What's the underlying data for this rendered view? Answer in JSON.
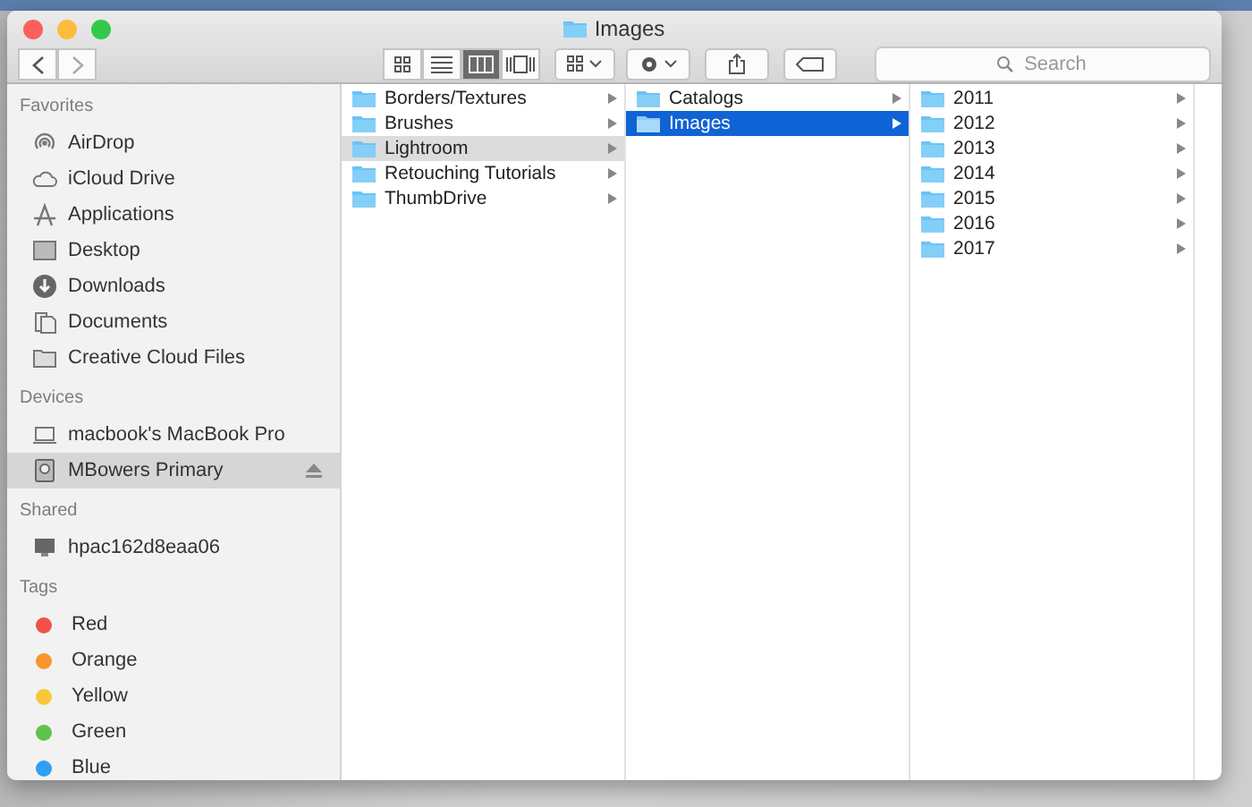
{
  "window": {
    "title": "Images"
  },
  "toolbar": {
    "views": [
      {
        "kind": "icons",
        "selected": false
      },
      {
        "kind": "list",
        "selected": false
      },
      {
        "kind": "columns",
        "selected": true
      },
      {
        "kind": "coverflow",
        "selected": false
      }
    ],
    "search": {
      "placeholder": "Search"
    }
  },
  "sidebar": {
    "sections": [
      {
        "title": "Favorites",
        "items": [
          {
            "label": "AirDrop",
            "selected": false
          },
          {
            "label": "iCloud Drive",
            "selected": false
          },
          {
            "label": "Applications",
            "selected": false
          },
          {
            "label": "Desktop",
            "selected": false
          },
          {
            "label": "Downloads",
            "selected": false
          },
          {
            "label": "Documents",
            "selected": false
          },
          {
            "label": "Creative Cloud Files",
            "selected": false
          }
        ]
      },
      {
        "title": "Devices",
        "items": [
          {
            "label": "macbook's MacBook Pro",
            "selected": false,
            "ejectable": false
          },
          {
            "label": "MBowers Primary",
            "selected": true,
            "ejectable": true
          }
        ]
      },
      {
        "title": "Shared",
        "items": [
          {
            "label": "hpac162d8eaa06",
            "selected": false
          }
        ]
      },
      {
        "title": "Tags",
        "items": [
          {
            "label": "Red",
            "color": "#f0514a",
            "selected": false
          },
          {
            "label": "Orange",
            "color": "#f7962f",
            "selected": false
          },
          {
            "label": "Yellow",
            "color": "#f8c83a",
            "selected": false
          },
          {
            "label": "Green",
            "color": "#5fc24a",
            "selected": false
          },
          {
            "label": "Blue",
            "color": "#2f9ff1",
            "selected": false
          }
        ]
      }
    ]
  },
  "columns": [
    {
      "active": false,
      "items": [
        {
          "name": "Borders/Textures",
          "selected": false
        },
        {
          "name": "Brushes",
          "selected": false
        },
        {
          "name": "Lightroom",
          "selected": true
        },
        {
          "name": "Retouching Tutorials",
          "selected": false
        },
        {
          "name": "ThumbDrive",
          "selected": false
        }
      ]
    },
    {
      "active": true,
      "items": [
        {
          "name": "Catalogs",
          "selected": false
        },
        {
          "name": "Images",
          "selected": true
        }
      ]
    },
    {
      "items": [
        {
          "name": "2011",
          "selected": false
        },
        {
          "name": "2012",
          "selected": false
        },
        {
          "name": "2013",
          "selected": false
        },
        {
          "name": "2014",
          "selected": false
        },
        {
          "name": "2015",
          "selected": false
        },
        {
          "name": "2016",
          "selected": false
        },
        {
          "name": "2017",
          "selected": false
        }
      ]
    }
  ]
}
